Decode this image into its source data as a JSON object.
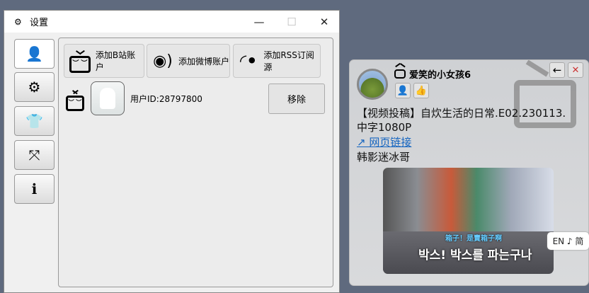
{
  "settings_window": {
    "title": "设置",
    "sidebar": [
      {
        "icon": "user-gear-icon",
        "glyph": "👤"
      },
      {
        "icon": "gear-icon",
        "glyph": "⚙"
      },
      {
        "icon": "shirt-icon",
        "glyph": "👕"
      },
      {
        "icon": "expand-icon",
        "glyph": "⤧"
      },
      {
        "icon": "info-icon",
        "glyph": "ℹ"
      }
    ],
    "add_buttons": [
      {
        "label": "添加B站账户",
        "icon": "bilibili-tv-icon"
      },
      {
        "label": "添加微博账户",
        "icon": "weibo-icon"
      },
      {
        "label": "添加RSS订阅源",
        "icon": "rss-icon"
      }
    ],
    "account": {
      "user_id": "用户ID:28797800",
      "remove_label": "移除"
    }
  },
  "card": {
    "username": "爱笑的小女孩6",
    "content": "【视频投稿】自炊生活的日常.E02.230113.",
    "content2": "中字1080P",
    "link": "↗ 网页链接",
    "author": "韩影迷冰哥",
    "thumb_subtitle": "박스! 박스를 파는구나",
    "thumb_caption": "箱子！是賣箱子啊"
  },
  "ime": {
    "label": "EN ♪ 简"
  }
}
